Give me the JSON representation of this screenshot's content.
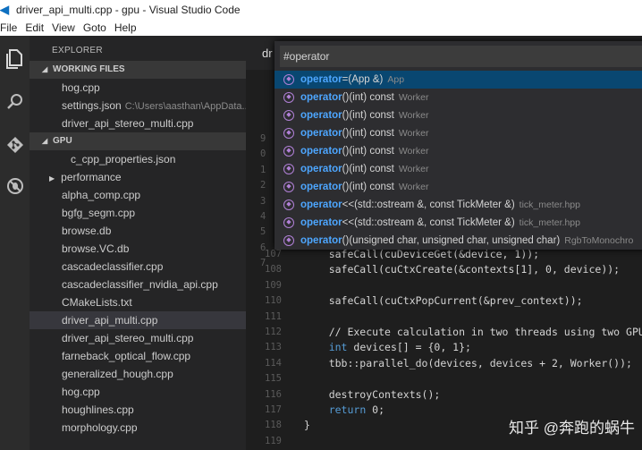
{
  "window": {
    "title": "driver_api_multi.cpp - gpu - Visual Studio Code"
  },
  "menu": [
    "File",
    "Edit",
    "View",
    "Goto",
    "Help"
  ],
  "activity_bar": {
    "icons": [
      "files-icon",
      "search-icon",
      "git-icon",
      "debug-icon"
    ]
  },
  "explorer": {
    "title": "EXPLORER",
    "working_files": {
      "title": "WORKING FILES",
      "items": [
        {
          "name": "hog.cpp",
          "path": ""
        },
        {
          "name": "settings.json",
          "path": "C:\\Users\\aasthan\\AppData..."
        },
        {
          "name": "driver_api_stereo_multi.cpp",
          "path": ""
        }
      ]
    },
    "gpu": {
      "title": "GPU",
      "items": [
        {
          "name": "c_cpp_properties.json",
          "kind": "file-indent"
        },
        {
          "name": "performance",
          "kind": "folder"
        },
        {
          "name": "alpha_comp.cpp",
          "kind": "file"
        },
        {
          "name": "bgfg_segm.cpp",
          "kind": "file"
        },
        {
          "name": "browse.db",
          "kind": "file"
        },
        {
          "name": "browse.VC.db",
          "kind": "file"
        },
        {
          "name": "cascadeclassifier.cpp",
          "kind": "file"
        },
        {
          "name": "cascadeclassifier_nvidia_api.cpp",
          "kind": "file"
        },
        {
          "name": "CMakeLists.txt",
          "kind": "file"
        },
        {
          "name": "driver_api_multi.cpp",
          "kind": "file",
          "selected": true
        },
        {
          "name": "driver_api_stereo_multi.cpp",
          "kind": "file"
        },
        {
          "name": "farneback_optical_flow.cpp",
          "kind": "file"
        },
        {
          "name": "generalized_hough.cpp",
          "kind": "file"
        },
        {
          "name": "hog.cpp",
          "kind": "file"
        },
        {
          "name": "houghlines.cpp",
          "kind": "file"
        },
        {
          "name": "morphology.cpp",
          "kind": "file"
        }
      ]
    }
  },
  "editor": {
    "tab_label": "dr",
    "symbol_search": {
      "value": "#operator",
      "results": [
        {
          "keyword": "operator",
          "signature": "=(App &)",
          "container": "App"
        },
        {
          "keyword": "operator",
          "signature": "()(int) const",
          "container": "Worker"
        },
        {
          "keyword": "operator",
          "signature": "()(int) const",
          "container": "Worker"
        },
        {
          "keyword": "operator",
          "signature": "()(int) const",
          "container": "Worker"
        },
        {
          "keyword": "operator",
          "signature": "()(int) const",
          "container": "Worker"
        },
        {
          "keyword": "operator",
          "signature": "()(int) const",
          "container": "Worker"
        },
        {
          "keyword": "operator",
          "signature": "()(int) const",
          "container": "Worker"
        },
        {
          "keyword": "operator",
          "signature": "<<(std::ostream &, const TickMeter &)",
          "container": "tick_meter.hpp"
        },
        {
          "keyword": "operator",
          "signature": "<<(std::ostream &, const TickMeter &)",
          "container": "tick_meter.hpp"
        },
        {
          "keyword": "operator",
          "signature": "()(unsigned char, unsigned char, unsigned char)",
          "container": "RgbToMonochro"
        }
      ]
    },
    "gutter_partial": [
      "9",
      "0",
      "1",
      "2",
      "3",
      "4",
      "5",
      "6",
      "7"
    ],
    "code_lines": [
      {
        "n": "107",
        "text": "    safeCall(cuDeviceGet(&device, 1));",
        "style": ""
      },
      {
        "n": "108",
        "text": "    safeCall(cuCtxCreate(&contexts[1], 0, device));",
        "style": ""
      },
      {
        "n": "109",
        "text": "",
        "style": ""
      },
      {
        "n": "110",
        "text": "    safeCall(cuCtxPopCurrent(&prev_context));",
        "style": ""
      },
      {
        "n": "111",
        "text": "",
        "style": ""
      },
      {
        "n": "112",
        "text": "    // Execute calculation in two threads using two GPUs",
        "style": "comment"
      },
      {
        "n": "113",
        "text": "    int devices[] = {0, 1};",
        "style": "int"
      },
      {
        "n": "114",
        "text": "    tbb::parallel_do(devices, devices + 2, Worker());",
        "style": ""
      },
      {
        "n": "115",
        "text": "",
        "style": ""
      },
      {
        "n": "116",
        "text": "    destroyContexts();",
        "style": ""
      },
      {
        "n": "117",
        "text": "    return 0;",
        "style": ""
      },
      {
        "n": "118",
        "text": "}",
        "style": ""
      },
      {
        "n": "119",
        "text": "",
        "style": ""
      }
    ]
  },
  "watermark": "知乎 @奔跑的蜗牛",
  "colors": {
    "accent": "#094771",
    "keyword": "#4da6ff",
    "comment": "#57a64a"
  }
}
